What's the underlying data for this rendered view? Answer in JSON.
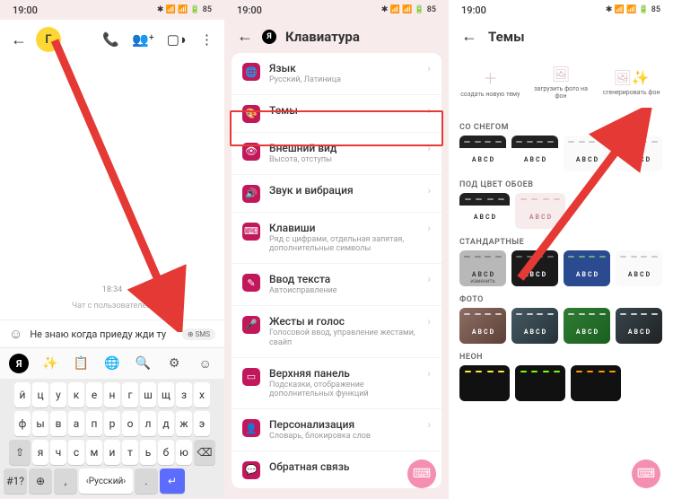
{
  "status": {
    "time": "19:00",
    "battery": "85"
  },
  "s1": {
    "avatar_initial": "Г",
    "chat": {
      "timestamp": "18:34",
      "info": "Чат с пользователем"
    },
    "input_text": "Не знаю когда приеду жди ту",
    "sms": "SMS",
    "kb": {
      "row1": [
        "й",
        "ц",
        "у",
        "к",
        "е",
        "н",
        "г",
        "ш",
        "щ",
        "з",
        "х"
      ],
      "row2": [
        "ф",
        "ы",
        "в",
        "а",
        "п",
        "р",
        "о",
        "л",
        "д",
        "ж",
        "э"
      ],
      "row3": [
        "я",
        "ч",
        "с",
        "м",
        "и",
        "т",
        "ь",
        "б",
        "ю"
      ],
      "num_label": "#1?",
      "lang": "Русский"
    }
  },
  "s2": {
    "title": "Клавиатура",
    "items": [
      {
        "label": "Язык",
        "sub": "Русский, Латиница"
      },
      {
        "label": "Темы",
        "sub": ""
      },
      {
        "label": "Внешний вид",
        "sub": "Высота, отступы"
      },
      {
        "label": "Звук и вибрация",
        "sub": ""
      },
      {
        "label": "Клавиши",
        "sub": "Ряд с цифрами, отдельная запятая, дополнительные символы"
      },
      {
        "label": "Ввод текста",
        "sub": "Автоисправление"
      },
      {
        "label": "Жесты и голос",
        "sub": "Голосовой ввод, управление жестами, свайп"
      },
      {
        "label": "Верхняя панель",
        "sub": "Подсказки, отображение дополнительных функций"
      },
      {
        "label": "Персонализация",
        "sub": "Словарь, блокировка слов"
      },
      {
        "label": "Обратная связь",
        "sub": ""
      }
    ]
  },
  "s3": {
    "title": "Темы",
    "actions": [
      {
        "label": "создать новую тему"
      },
      {
        "label": "загрузить фото на фон"
      },
      {
        "label": "сгенерировать фон"
      }
    ],
    "sections": {
      "snow": "СО СНЕГОМ",
      "wallpaper": "ПОД ЦВЕТ ОБОЕВ",
      "standard": "СТАНДАРТНЫЕ",
      "photo": "ФОТО",
      "neon": "НЕОН"
    },
    "change_label": "изменить",
    "sample": {
      "a": "A",
      "b": "B",
      "c": "C",
      "d": "D"
    }
  }
}
